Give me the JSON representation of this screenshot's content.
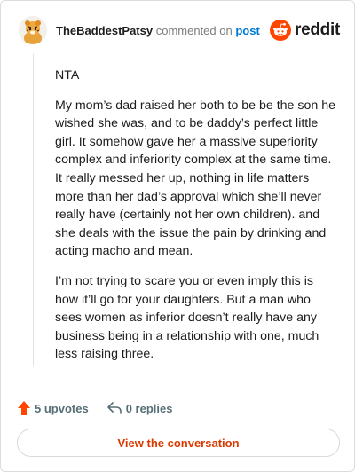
{
  "header": {
    "username": "TheBaddestPatsy",
    "action_text": "commented on",
    "post_link_text": "post",
    "brand_word": "reddit",
    "brand_color": "#ff4500"
  },
  "comment": {
    "paragraphs": [
      "NTA",
      "My mom’s dad raised her both to be be the son he wished she was, and to be daddy’s perfect little girl. It somehow gave her a massive superiority complex and inferiority complex at the same time. It really messed her up, nothing in life matters more than her dad’s approval which she’ll never really have (certainly not her own children). and she deals with the issue the pain by drinking and acting macho and mean.",
      "I’m not trying to scare you or even imply this is how it’ll go for your daughters. But a man who sees women as inferior doesn’t really have any business being in a relationship with one, much less raising three."
    ]
  },
  "footer": {
    "upvotes_label": "5 upvotes",
    "replies_label": "0 replies",
    "upvote_icon": "upvote-arrow-icon",
    "reply_icon": "reply-arrow-icon",
    "upvote_color": "#ff4500"
  },
  "cta": {
    "label": "View the conversation",
    "color": "#d93a00"
  }
}
